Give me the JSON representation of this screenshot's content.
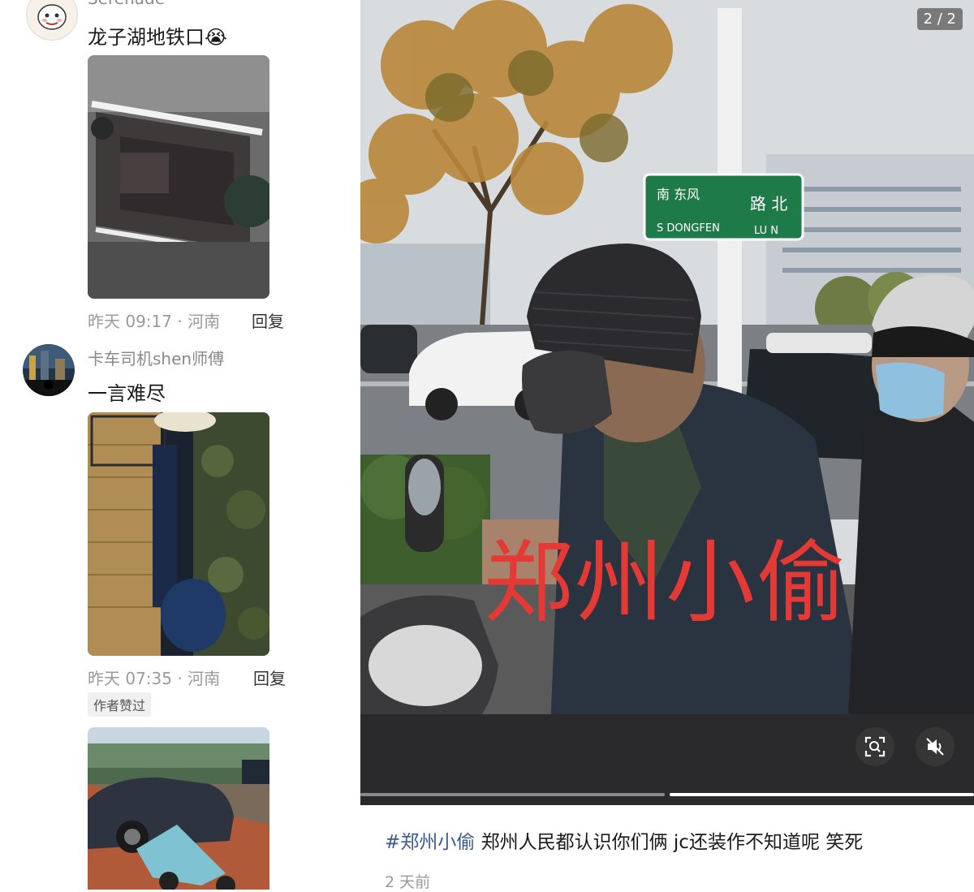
{
  "comments": [
    {
      "username": "Serenade",
      "text": "龙子湖地铁口😭",
      "meta": "昨天 09:17 · 河南",
      "reply": "回复"
    },
    {
      "username": "卡车司机shen师傅",
      "text": "一言难尽",
      "meta": "昨天 07:35 · 河南",
      "reply": "回复",
      "badge": "作者赞过"
    }
  ],
  "post": {
    "counter": "2 / 2",
    "overlay_text": "郑州小偷",
    "sign_text": {
      "line1": "南 东风",
      "line2": "S DONGFEN",
      "line3": "LU N",
      "road": "路 北"
    },
    "hashtag": "#郑州小偷",
    "caption": "郑州人民都认识你们俩 jc还装作不知道呢  笑死",
    "time": "2 天前",
    "progress_segments": 2,
    "active_segment": 2
  },
  "icons": {
    "scan": "scan-icon",
    "mute": "mute-icon"
  }
}
